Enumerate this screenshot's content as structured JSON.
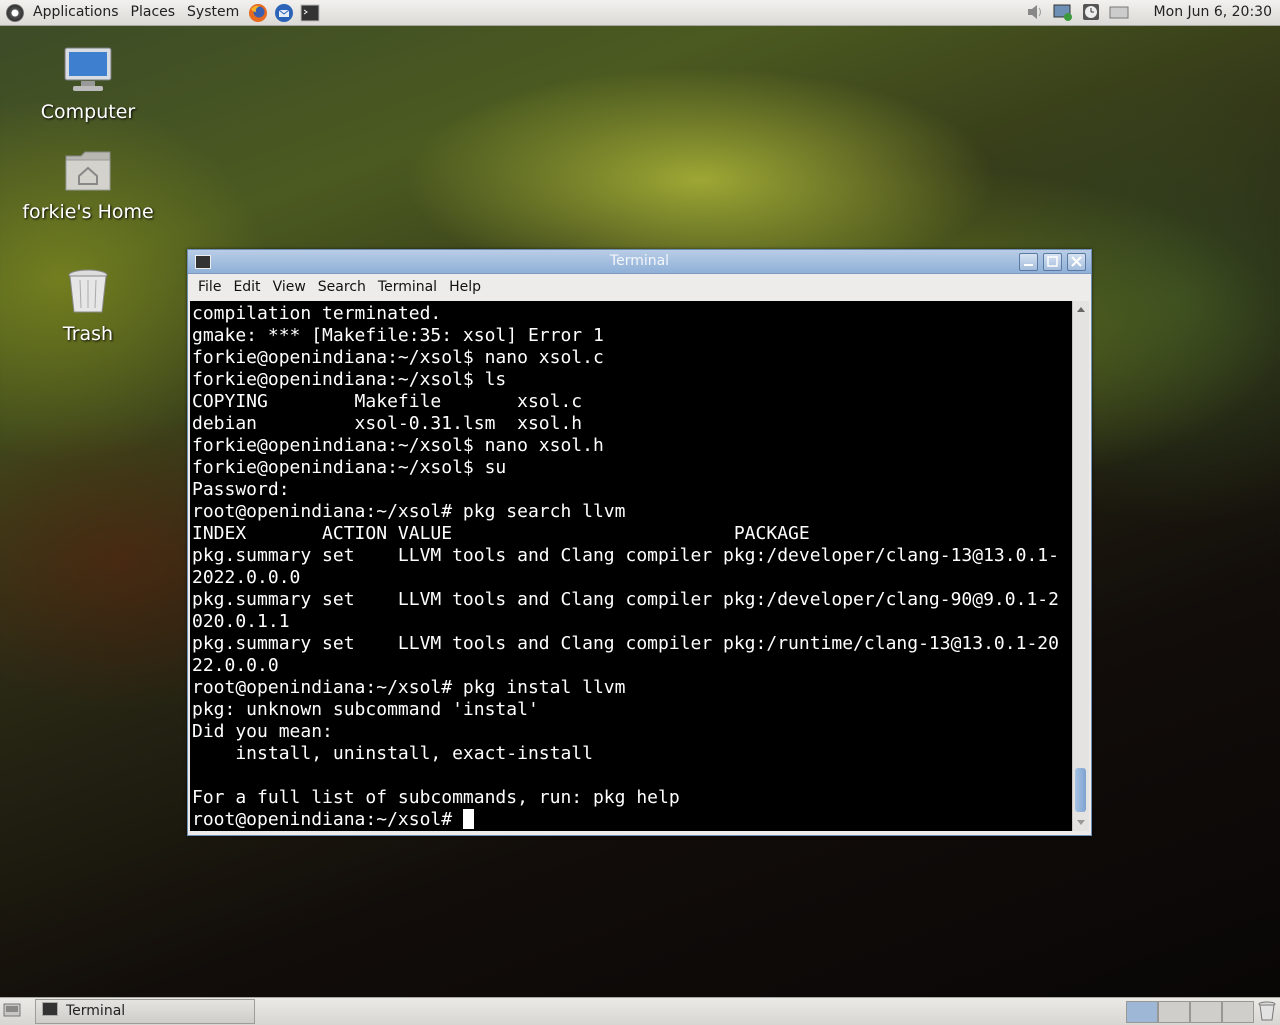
{
  "top_panel": {
    "menus": [
      "Applications",
      "Places",
      "System"
    ],
    "launchers": [
      "firefox-icon",
      "thunderbird-icon",
      "terminal-launcher-icon"
    ],
    "tray_icons": [
      "volume-icon",
      "network-icon",
      "clock-app-icon",
      "display-icon"
    ],
    "clock": "Mon Jun  6, 20:30"
  },
  "desktop": {
    "icons": [
      {
        "label": "Computer",
        "icon": "computer-icon"
      },
      {
        "label": "forkie's Home",
        "icon": "home-folder-icon"
      },
      {
        "label": "Trash",
        "icon": "trash-icon"
      }
    ]
  },
  "terminal_window": {
    "title": "Terminal",
    "menu": [
      "File",
      "Edit",
      "View",
      "Search",
      "Terminal",
      "Help"
    ],
    "lines": [
      "compilation terminated.",
      "gmake: *** [Makefile:35: xsol] Error 1",
      "forkie@openindiana:~/xsol$ nano xsol.c",
      "forkie@openindiana:~/xsol$ ls",
      "COPYING        Makefile       xsol.c",
      "debian         xsol-0.31.lsm  xsol.h",
      "forkie@openindiana:~/xsol$ nano xsol.h",
      "forkie@openindiana:~/xsol$ su",
      "Password:",
      "root@openindiana:~/xsol# pkg search llvm",
      "INDEX       ACTION VALUE                          PACKAGE",
      "pkg.summary set    LLVM tools and Clang compiler pkg:/developer/clang-13@13.0.1-",
      "2022.0.0.0",
      "pkg.summary set    LLVM tools and Clang compiler pkg:/developer/clang-90@9.0.1-2",
      "020.0.1.1",
      "pkg.summary set    LLVM tools and Clang compiler pkg:/runtime/clang-13@13.0.1-20",
      "22.0.0.0",
      "root@openindiana:~/xsol# pkg instal llvm",
      "pkg: unknown subcommand 'instal'",
      "Did you mean:",
      "    install, uninstall, exact-install",
      "",
      "For a full list of subcommands, run: pkg help"
    ],
    "prompt": "root@openindiana:~/xsol# "
  },
  "bottom_panel": {
    "task_label": "Terminal",
    "workspaces": 4,
    "active_workspace": 1
  }
}
